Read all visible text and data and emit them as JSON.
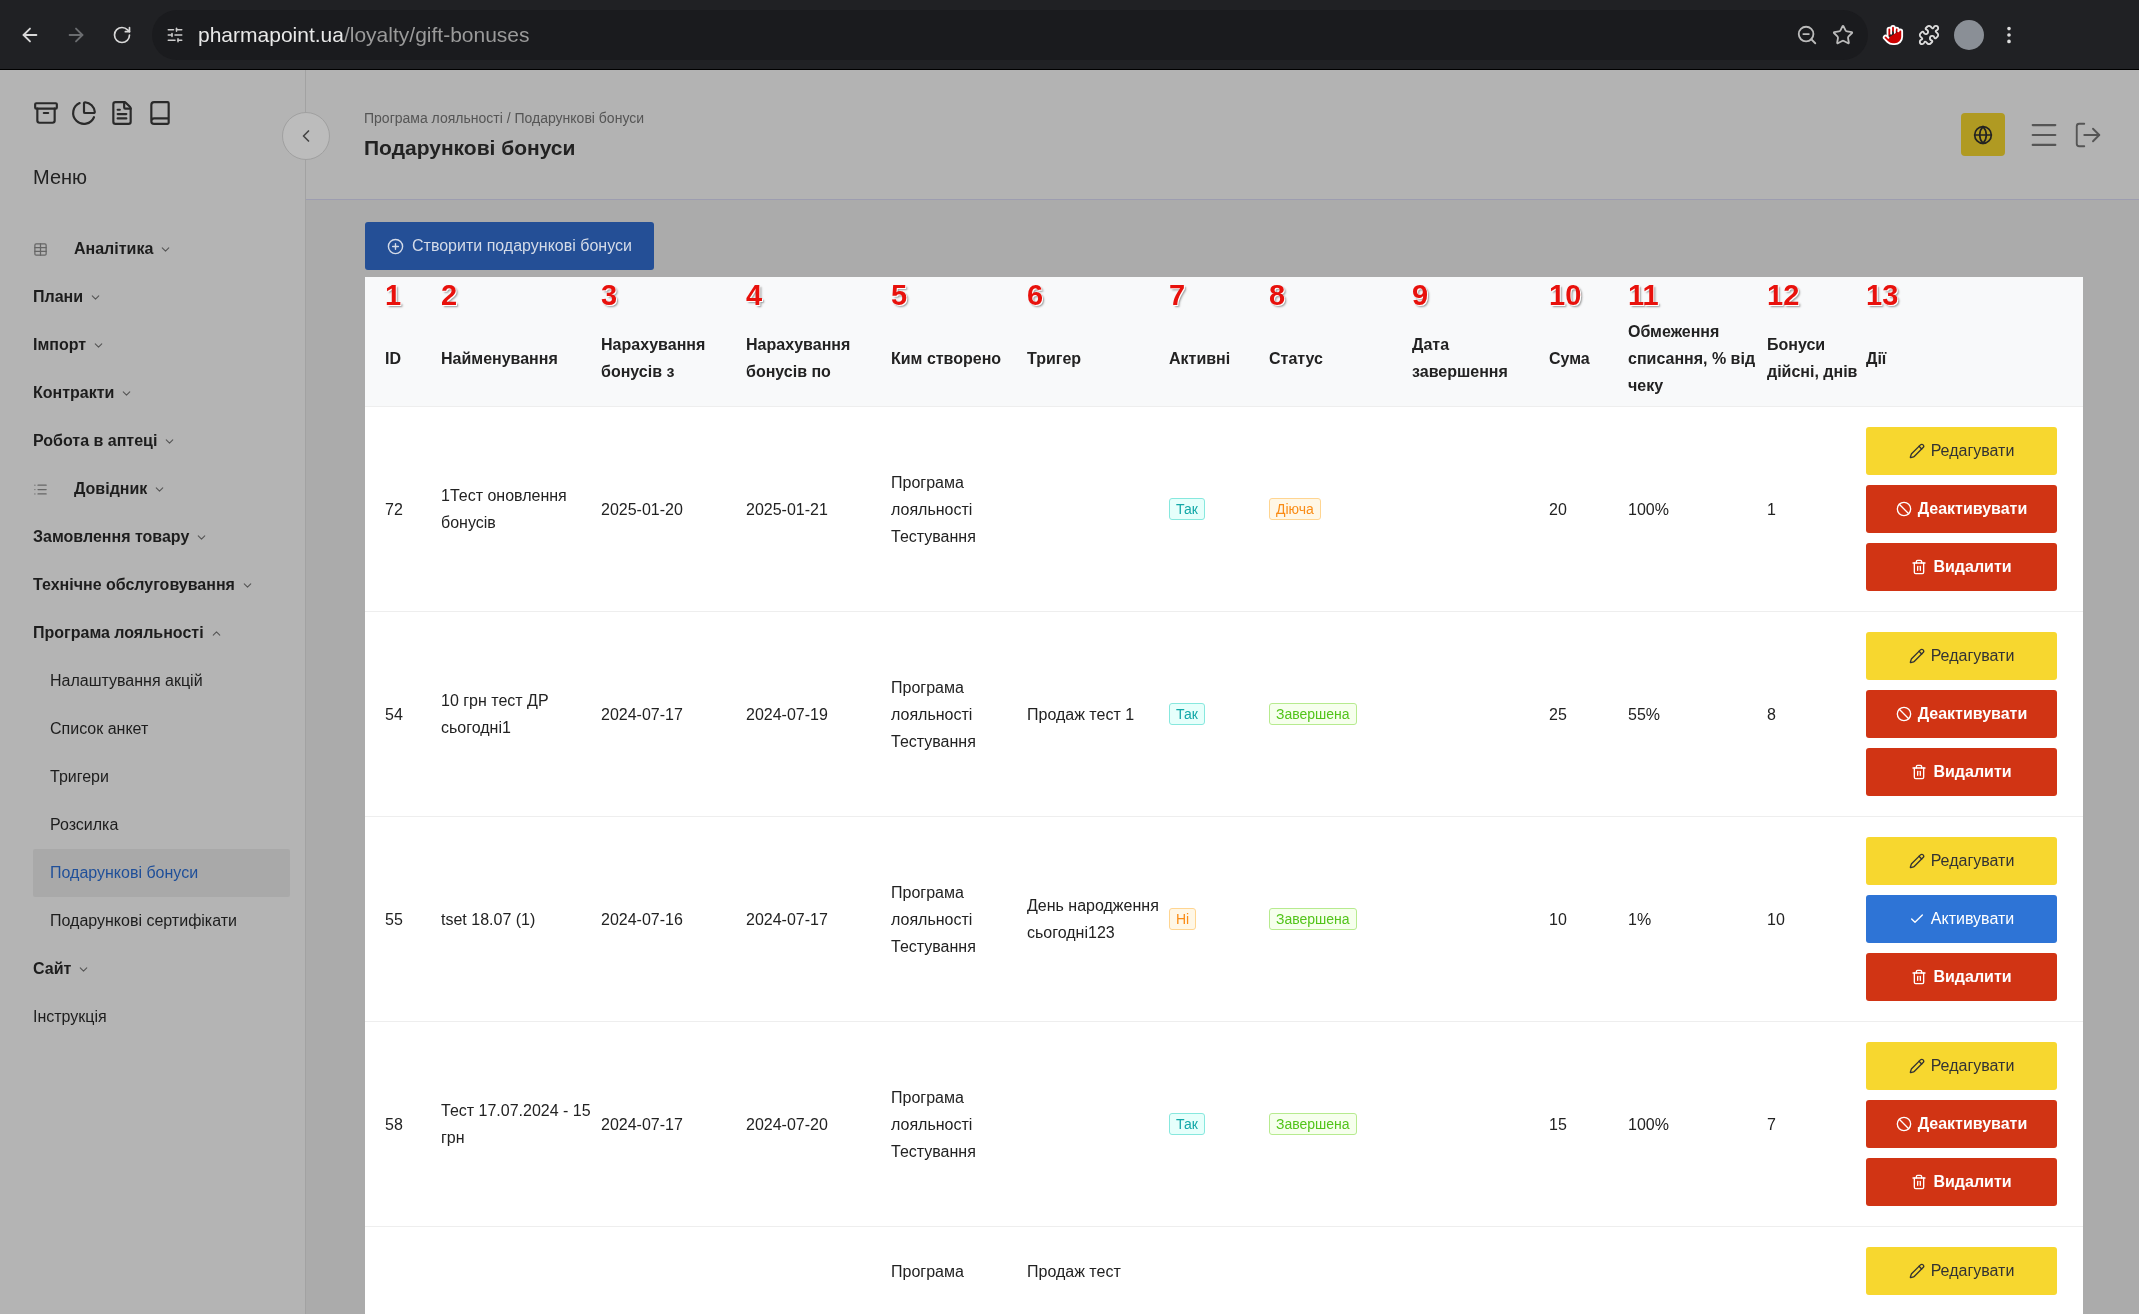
{
  "browser": {
    "url_host": "pharmapoint.ua",
    "url_path": "/loyalty/gift-bonuses"
  },
  "sidebar": {
    "title": "Меню",
    "items": [
      {
        "label": "Аналітика",
        "kind": "group",
        "expanded": false
      },
      {
        "label": "Плани",
        "kind": "group",
        "expanded": false
      },
      {
        "label": "Імпорт",
        "kind": "group",
        "expanded": false
      },
      {
        "label": "Контракти",
        "kind": "group",
        "expanded": false
      },
      {
        "label": "Робота в аптеці",
        "kind": "group",
        "expanded": false
      },
      {
        "label": "Довідник",
        "kind": "group",
        "expanded": false
      },
      {
        "label": "Замовлення товару",
        "kind": "group",
        "expanded": false
      },
      {
        "label": "Технічне обслуговування",
        "kind": "group",
        "expanded": false
      },
      {
        "label": "Програма лояльності",
        "kind": "group",
        "expanded": true,
        "children": [
          {
            "label": "Налаштування акцій",
            "selected": false
          },
          {
            "label": "Список анкет",
            "selected": false
          },
          {
            "label": "Тригери",
            "selected": false
          },
          {
            "label": "Розсилка",
            "selected": false
          },
          {
            "label": "Подарункові бонуси",
            "selected": true
          },
          {
            "label": "Подарункові сертифікати",
            "selected": false
          }
        ]
      },
      {
        "label": "Сайт",
        "kind": "group",
        "expanded": false
      },
      {
        "label": "Інструкція",
        "kind": "link"
      }
    ]
  },
  "header": {
    "breadcrumb": "Програма лояльності / Подарункові бонуси",
    "title": "Подарункові бонуси"
  },
  "create_button": "Створити подарункові бонуси",
  "table": {
    "columns": [
      {
        "marker": "1",
        "label": "ID"
      },
      {
        "marker": "2",
        "label": "Найменування"
      },
      {
        "marker": "3",
        "label": "Нарахування бонусів з"
      },
      {
        "marker": "4",
        "label": "Нарахування бонусів по"
      },
      {
        "marker": "5",
        "label": "Ким створено"
      },
      {
        "marker": "6",
        "label": "Тригер"
      },
      {
        "marker": "7",
        "label": "Активні"
      },
      {
        "marker": "8",
        "label": "Статус"
      },
      {
        "marker": "9",
        "label": "Дата завершення"
      },
      {
        "marker": "10",
        "label": "Сума"
      },
      {
        "marker": "11",
        "label": "Обмеження списання, % від чеку"
      },
      {
        "marker": "12",
        "label": "Бонуси дійсні, днів"
      },
      {
        "marker": "13",
        "label": "Дії"
      }
    ],
    "rows": [
      {
        "id": "72",
        "name": "1Тест оновлення бонусів",
        "from": "2025-01-20",
        "to": "2025-01-21",
        "creator": "Програма лояльності Тестування",
        "active": {
          "label": "Так",
          "on": true
        },
        "status": {
          "label": "Діюча",
          "kind": "running"
        },
        "sum": "20",
        "limit": "100%",
        "days": "1",
        "actions": [
          {
            "kind": "edit",
            "label": "Редагувати"
          },
          {
            "kind": "deactivate",
            "label": "Деактивувати"
          },
          {
            "kind": "delete",
            "label": "Видалити"
          }
        ]
      },
      {
        "id": "54",
        "name": "10 грн тест ДР сьогодні1",
        "from": "2024-07-17",
        "to": "2024-07-19",
        "creator": "Програма лояльності Тестування",
        "trigger": "Продаж тест 1",
        "active": {
          "label": "Так",
          "on": true
        },
        "status": {
          "label": "Завершена",
          "kind": "finished"
        },
        "sum": "25",
        "limit": "55%",
        "days": "8",
        "actions": [
          {
            "kind": "edit",
            "label": "Редагувати"
          },
          {
            "kind": "deactivate",
            "label": "Деактивувати"
          },
          {
            "kind": "delete",
            "label": "Видалити"
          }
        ]
      },
      {
        "id": "55",
        "name": "tset 18.07 (1)",
        "from": "2024-07-16",
        "to": "2024-07-17",
        "creator": "Програма лояльності Тестування",
        "trigger": "День народження сьогодні123",
        "active": {
          "label": "Ні",
          "on": false
        },
        "status": {
          "label": "Завершена",
          "kind": "finished"
        },
        "sum": "10",
        "limit": "1%",
        "days": "10",
        "actions": [
          {
            "kind": "edit",
            "label": "Редагувати"
          },
          {
            "kind": "activate",
            "label": "Активувати"
          },
          {
            "kind": "delete",
            "label": "Видалити"
          }
        ]
      },
      {
        "id": "58",
        "name": "Тест 17.07.2024 - 15 грн",
        "from": "2024-07-17",
        "to": "2024-07-20",
        "creator": "Програма лояльності Тестування",
        "active": {
          "label": "Так",
          "on": true
        },
        "status": {
          "label": "Завершена",
          "kind": "finished"
        },
        "sum": "15",
        "limit": "100%",
        "days": "7",
        "actions": [
          {
            "kind": "edit",
            "label": "Редагувати"
          },
          {
            "kind": "deactivate",
            "label": "Деактивувати"
          },
          {
            "kind": "delete",
            "label": "Видалити"
          }
        ]
      },
      {
        "creator": "Програма",
        "trigger": "Продаж тест",
        "actions": [
          {
            "kind": "edit",
            "label": "Редагувати"
          }
        ]
      }
    ]
  }
}
